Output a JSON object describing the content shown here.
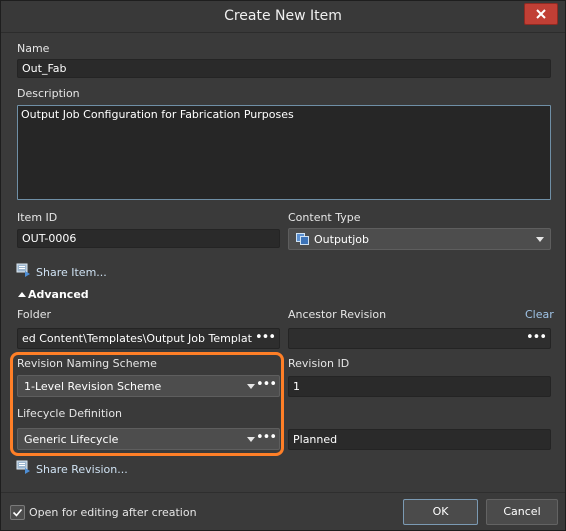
{
  "window": {
    "title": "Create New Item",
    "close_icon": "close-icon"
  },
  "name": {
    "label": "Name",
    "value": "Out_Fab"
  },
  "description": {
    "label": "Description",
    "value": "Output Job Configuration for Fabrication Purposes"
  },
  "item_id": {
    "label": "Item ID",
    "value": "OUT-0006"
  },
  "content_type": {
    "label": "Content Type",
    "value": "Outputjob",
    "icon": "outputjob-icon"
  },
  "share_item": {
    "label": "Share Item...",
    "icon": "share-icon"
  },
  "advanced": {
    "label": "Advanced"
  },
  "folder": {
    "label": "Folder",
    "value": "ed Content\\Templates\\Output Job Templates",
    "browse": "•••"
  },
  "ancestor_revision": {
    "label": "Ancestor Revision",
    "clear_label": "Clear",
    "value": ""
  },
  "revision_naming_scheme": {
    "label": "Revision Naming Scheme",
    "value": "1-Level Revision Scheme",
    "browse": "•••"
  },
  "revision_id": {
    "label": "Revision ID",
    "value": "1"
  },
  "lifecycle_definition": {
    "label": "Lifecycle Definition",
    "value": "Generic Lifecycle",
    "browse": "•••"
  },
  "lifecycle_state": {
    "value": "Planned"
  },
  "share_revision": {
    "label": "Share Revision...",
    "icon": "share-icon"
  },
  "footer": {
    "open_for_editing_label": "Open for editing after creation",
    "open_for_editing_checked": true,
    "ok_label": "OK",
    "cancel_label": "Cancel"
  },
  "colors": {
    "highlight": "#ff7f27",
    "close_button": "#c13f35"
  }
}
